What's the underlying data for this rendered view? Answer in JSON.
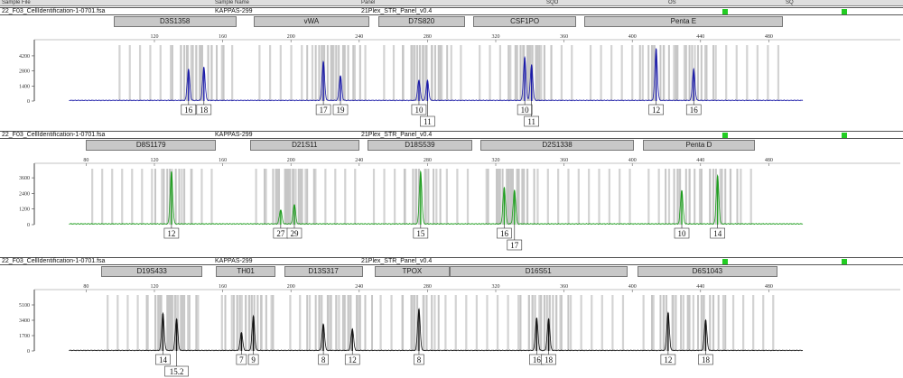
{
  "header": {
    "columns": [
      "Sample File",
      "Sample Name",
      "Panel",
      "SQO",
      "OS",
      "SQ"
    ]
  },
  "panels": [
    {
      "sample_file": "22_F03_CellIdentification-1-0701.fsa",
      "sample_name": "KAPPAS-299",
      "panel_name": "21Plex_STR_Panel_v0.4",
      "dye_color": "#1a1aa8",
      "x_ticks": [
        {
          "v": 120,
          "t": "120"
        },
        {
          "v": 160,
          "t": "160"
        },
        {
          "v": 200,
          "t": "200"
        },
        {
          "v": 240,
          "t": "240"
        },
        {
          "v": 280,
          "t": "280"
        },
        {
          "v": 320,
          "t": "320"
        },
        {
          "v": 360,
          "t": "360"
        },
        {
          "v": 400,
          "t": "400"
        },
        {
          "v": 440,
          "t": "440"
        },
        {
          "v": 480,
          "t": "480"
        }
      ],
      "y_ticks": [
        {
          "v": 0,
          "t": "0"
        },
        {
          "v": 1400,
          "t": "1400"
        },
        {
          "v": 2800,
          "t": "2800"
        },
        {
          "v": 4200,
          "t": "4200"
        }
      ],
      "y_max": 5200,
      "markers": [
        {
          "name": "D3S1358",
          "start": 96,
          "end": 168
        },
        {
          "name": "vWA",
          "start": 178,
          "end": 246
        },
        {
          "name": "D7S820",
          "start": 251,
          "end": 302
        },
        {
          "name": "CSF1PO",
          "start": 307,
          "end": 367
        },
        {
          "name": "Penta E",
          "start": 372,
          "end": 488
        }
      ],
      "peaks": [
        {
          "x": 140,
          "h": 2900
        },
        {
          "x": 149,
          "h": 3100
        },
        {
          "x": 219,
          "h": 3600
        },
        {
          "x": 229,
          "h": 2300
        },
        {
          "x": 275,
          "h": 1900
        },
        {
          "x": 280,
          "h": 1850
        },
        {
          "x": 337,
          "h": 4000
        },
        {
          "x": 341,
          "h": 3300
        },
        {
          "x": 414,
          "h": 4800
        },
        {
          "x": 436,
          "h": 2900
        }
      ],
      "alleles": [
        {
          "x": 140,
          "label": "16",
          "row": 0
        },
        {
          "x": 149,
          "label": "18",
          "row": 0
        },
        {
          "x": 219,
          "label": "17",
          "row": 0
        },
        {
          "x": 229,
          "label": "19",
          "row": 0
        },
        {
          "x": 275,
          "label": "10",
          "row": 0
        },
        {
          "x": 280,
          "label": "11",
          "row": 1
        },
        {
          "x": 337,
          "label": "10",
          "row": 0
        },
        {
          "x": 341,
          "label": "11",
          "row": 1
        },
        {
          "x": 414,
          "label": "12",
          "row": 0
        },
        {
          "x": 436,
          "label": "16",
          "row": 0
        }
      ]
    },
    {
      "sample_file": "22_F03_CellIdentification-1-0701.fsa",
      "sample_name": "KAPPAS-299",
      "panel_name": "21Plex_STR_Panel_v0.4",
      "dye_color": "#1f9d1f",
      "x_ticks": [
        {
          "v": 80,
          "t": "80"
        },
        {
          "v": 120,
          "t": "120"
        },
        {
          "v": 160,
          "t": "160"
        },
        {
          "v": 200,
          "t": "200"
        },
        {
          "v": 240,
          "t": "240"
        },
        {
          "v": 280,
          "t": "280"
        },
        {
          "v": 320,
          "t": "320"
        },
        {
          "v": 360,
          "t": "360"
        },
        {
          "v": 400,
          "t": "400"
        },
        {
          "v": 440,
          "t": "440"
        },
        {
          "v": 480,
          "t": "480"
        }
      ],
      "y_ticks": [
        {
          "v": 0,
          "t": "0"
        },
        {
          "v": 1200,
          "t": "1200"
        },
        {
          "v": 2400,
          "t": "2400"
        },
        {
          "v": 3600,
          "t": "3600"
        }
      ],
      "y_max": 4300,
      "markers": [
        {
          "name": "D8S1179",
          "start": 80,
          "end": 156
        },
        {
          "name": "D21S11",
          "start": 176,
          "end": 240
        },
        {
          "name": "D18S539",
          "start": 245,
          "end": 306
        },
        {
          "name": "D2S1338",
          "start": 311,
          "end": 401
        },
        {
          "name": "Penta D",
          "start": 406,
          "end": 472
        }
      ],
      "peaks": [
        {
          "x": 130,
          "h": 4000
        },
        {
          "x": 194,
          "h": 1100
        },
        {
          "x": 202,
          "h": 1500
        },
        {
          "x": 276,
          "h": 4000
        },
        {
          "x": 325,
          "h": 2800
        },
        {
          "x": 331,
          "h": 2600
        },
        {
          "x": 429,
          "h": 2600
        },
        {
          "x": 450,
          "h": 3700
        }
      ],
      "alleles": [
        {
          "x": 130,
          "label": "12",
          "row": 0
        },
        {
          "x": 194,
          "label": "27",
          "row": 0
        },
        {
          "x": 202,
          "label": "29",
          "row": 0
        },
        {
          "x": 276,
          "label": "15",
          "row": 0
        },
        {
          "x": 325,
          "label": "16",
          "row": 0
        },
        {
          "x": 331,
          "label": "17",
          "row": 1
        },
        {
          "x": 429,
          "label": "10",
          "row": 0
        },
        {
          "x": 450,
          "label": "14",
          "row": 0
        }
      ]
    },
    {
      "sample_file": "22_F03_CellIdentification-1-0701.fsa",
      "sample_name": "KAPPAS-299",
      "panel_name": "21Plex_STR_Panel_v0.4",
      "dye_color": "#111111",
      "x_ticks": [
        {
          "v": 80,
          "t": "80"
        },
        {
          "v": 120,
          "t": "120"
        },
        {
          "v": 160,
          "t": "160"
        },
        {
          "v": 200,
          "t": "200"
        },
        {
          "v": 240,
          "t": "240"
        },
        {
          "v": 280,
          "t": "280"
        },
        {
          "v": 320,
          "t": "320"
        },
        {
          "v": 360,
          "t": "360"
        },
        {
          "v": 400,
          "t": "400"
        },
        {
          "v": 440,
          "t": "440"
        },
        {
          "v": 480,
          "t": "480"
        }
      ],
      "y_ticks": [
        {
          "v": 0,
          "t": "0"
        },
        {
          "v": 1700,
          "t": "1700"
        },
        {
          "v": 3400,
          "t": "3400"
        },
        {
          "v": 5100,
          "t": "5100"
        }
      ],
      "y_max": 6200,
      "markers": [
        {
          "name": "D19S433",
          "start": 89,
          "end": 148
        },
        {
          "name": "TH01",
          "start": 156,
          "end": 191
        },
        {
          "name": "D13S317",
          "start": 196,
          "end": 242
        },
        {
          "name": "TPOX",
          "start": 249,
          "end": 293
        },
        {
          "name": "D16S51",
          "start": 293,
          "end": 397
        },
        {
          "name": "D6S1043",
          "start": 403,
          "end": 485
        }
      ],
      "peaks": [
        {
          "x": 125,
          "h": 4100
        },
        {
          "x": 133,
          "h": 3500
        },
        {
          "x": 171,
          "h": 2000
        },
        {
          "x": 178,
          "h": 3800
        },
        {
          "x": 219,
          "h": 2900
        },
        {
          "x": 236,
          "h": 2400
        },
        {
          "x": 275,
          "h": 4600
        },
        {
          "x": 344,
          "h": 3600
        },
        {
          "x": 351,
          "h": 3500
        },
        {
          "x": 421,
          "h": 4200
        },
        {
          "x": 443,
          "h": 3400
        }
      ],
      "alleles": [
        {
          "x": 125,
          "label": "14",
          "row": 0
        },
        {
          "x": 133,
          "label": "15.2",
          "row": 1
        },
        {
          "x": 171,
          "label": "7",
          "row": 0
        },
        {
          "x": 178,
          "label": "9",
          "row": 0
        },
        {
          "x": 219,
          "label": "8",
          "row": 0
        },
        {
          "x": 236,
          "label": "12",
          "row": 0
        },
        {
          "x": 275,
          "label": "8",
          "row": 0
        },
        {
          "x": 344,
          "label": "16",
          "row": 0
        },
        {
          "x": 351,
          "label": "18",
          "row": 0
        },
        {
          "x": 421,
          "label": "12",
          "row": 0
        },
        {
          "x": 443,
          "label": "18",
          "row": 0
        }
      ]
    }
  ]
}
